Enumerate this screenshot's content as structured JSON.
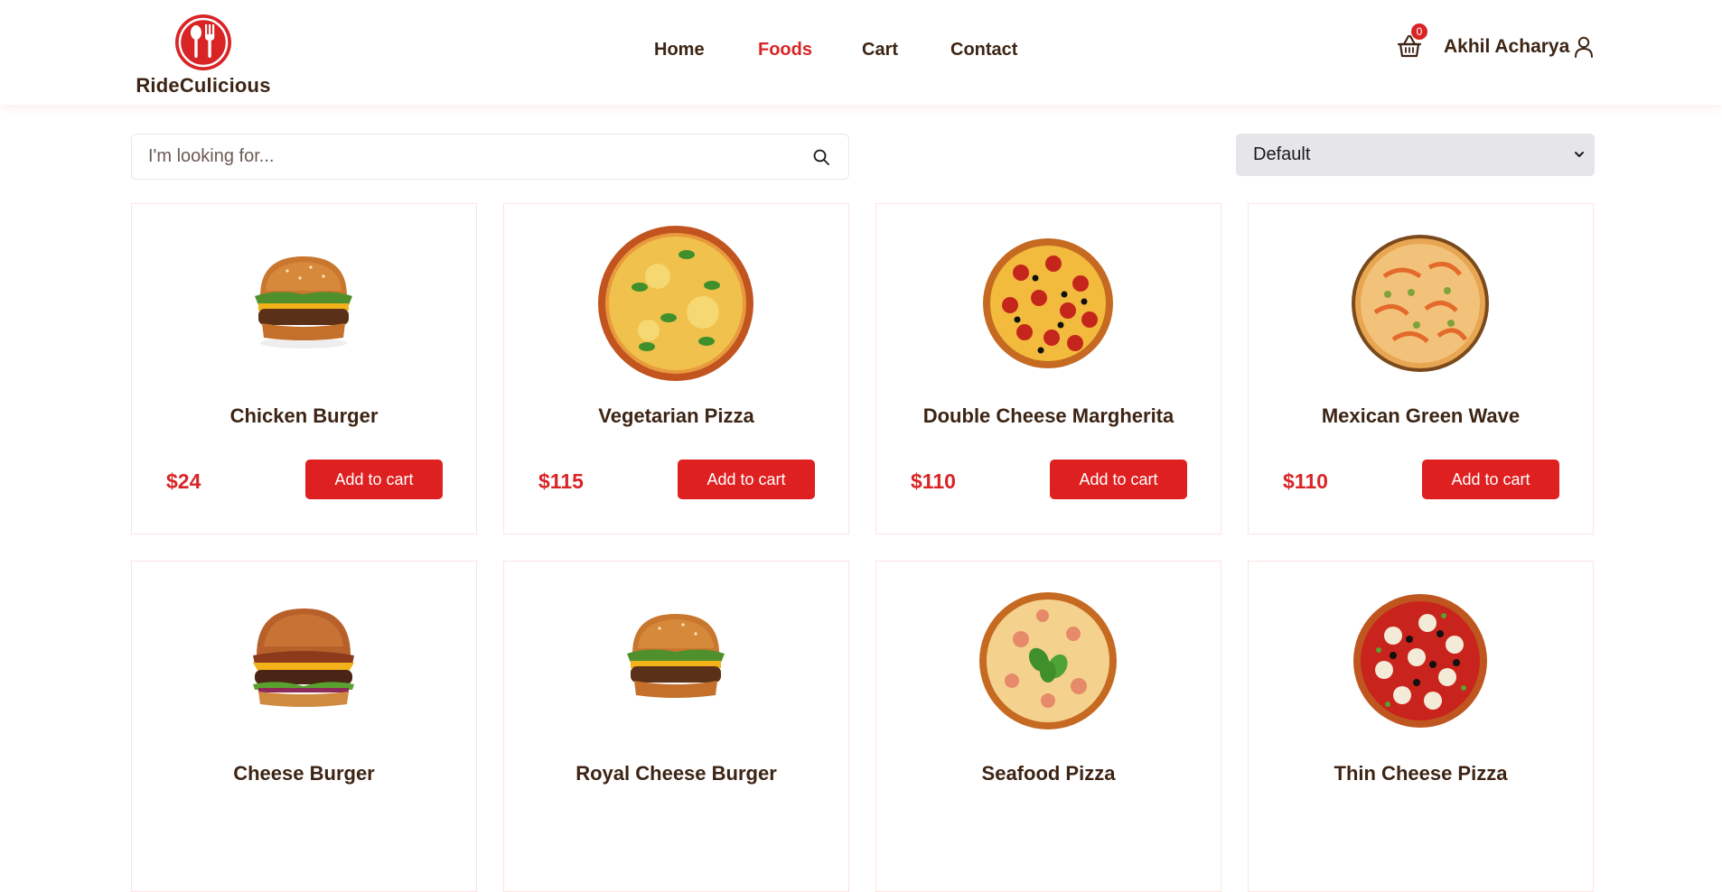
{
  "brand": {
    "name": "RideCulicious",
    "accent": "#d92426",
    "text_color": "#3d2414"
  },
  "nav": {
    "items": [
      {
        "label": "Home",
        "active": false
      },
      {
        "label": "Foods",
        "active": true
      },
      {
        "label": "Cart",
        "active": false
      },
      {
        "label": "Contact",
        "active": false
      }
    ]
  },
  "header": {
    "cart_count": "0",
    "user_name": "Akhil Acharya",
    "icons": [
      "shopping-basket-icon",
      "user-icon"
    ]
  },
  "search": {
    "placeholder": "I'm looking for...",
    "value": ""
  },
  "sort": {
    "selected": "Default"
  },
  "products": [
    {
      "title": "Chicken Burger",
      "price": "$24",
      "button": "Add to cart",
      "image": "burger"
    },
    {
      "title": "Vegetarian Pizza",
      "price": "$115",
      "button": "Add to cart",
      "image": "pizza-veg"
    },
    {
      "title": "Double Cheese Margherita",
      "price": "$110",
      "button": "Add to cart",
      "image": "pizza-pepperoni"
    },
    {
      "title": "Mexican Green Wave",
      "price": "$110",
      "button": "Add to cart",
      "image": "pizza-mexican"
    },
    {
      "title": "Cheese Burger",
      "price": "",
      "button": "",
      "image": "burger-bacon"
    },
    {
      "title": "Royal Cheese Burger",
      "price": "",
      "button": "",
      "image": "burger"
    },
    {
      "title": "Seafood Pizza",
      "price": "",
      "button": "",
      "image": "pizza-seafood"
    },
    {
      "title": "Thin Cheese Pizza",
      "price": "",
      "button": "",
      "image": "pizza-thin"
    }
  ]
}
